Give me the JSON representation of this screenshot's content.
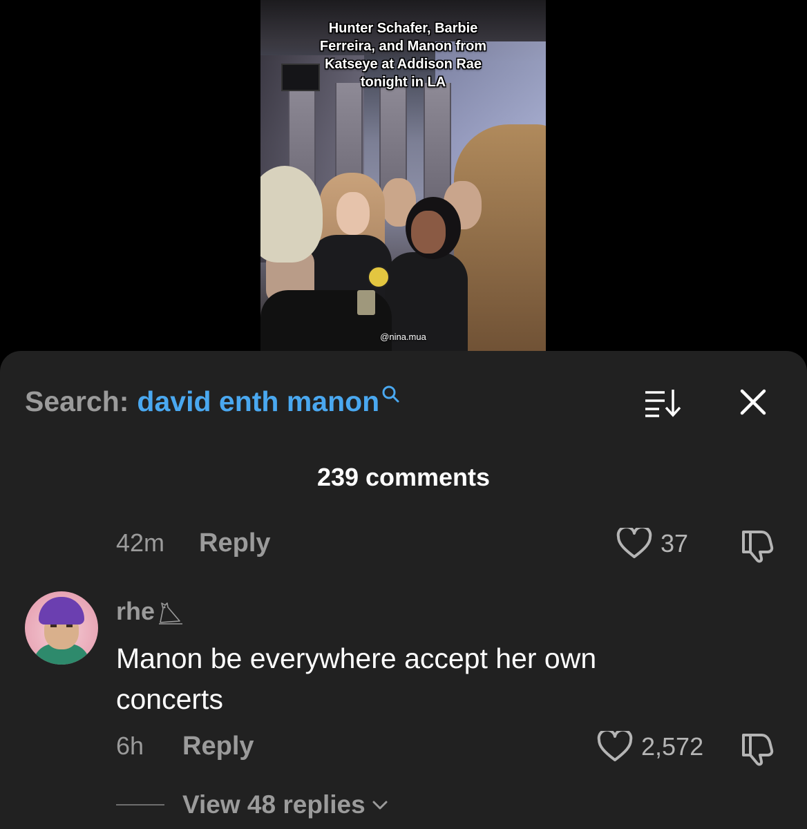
{
  "video": {
    "caption": "Hunter Schafer, Barbie\nFerreira, and Manon from\nKatseye at Addison Rae\ntonight in LA",
    "watermark": "@nina.mua"
  },
  "search": {
    "prefix": "Search:",
    "term": "david enth manon",
    "icon": "search-icon"
  },
  "header_icons": {
    "sort": "sort-icon",
    "close": "close-icon"
  },
  "comment_count": "239 comments",
  "previous_comment": {
    "time": "42m",
    "reply_label": "Reply",
    "likes": "37"
  },
  "comment": {
    "username": "rhe",
    "username_icon": "owl-icon",
    "text": "Manon be everywhere accept her own concerts",
    "time": "6h",
    "reply_label": "Reply",
    "likes": "2,572",
    "view_replies": "View 48 replies"
  },
  "colors": {
    "background": "#000000",
    "sheet": "#212121",
    "accent": "#4aa8f0",
    "muted": "#9b9b9b"
  }
}
